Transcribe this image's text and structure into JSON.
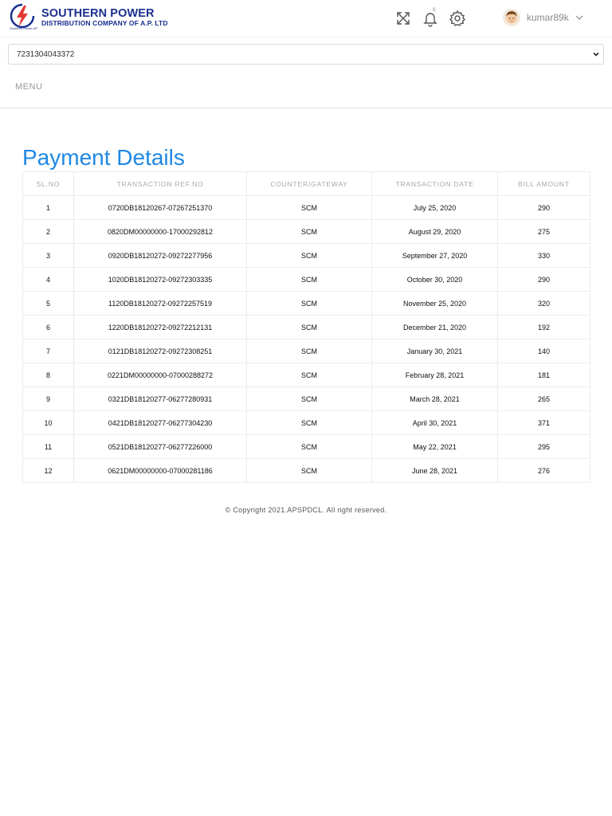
{
  "header": {
    "brand_line1": "SOUTHERN POWER",
    "brand_line2": "DISTRIBUTION COMPANY OF A.P. LTD",
    "brand_tagline": "Southern Power AP",
    "notification_count": "0",
    "username": "kumar89k",
    "icons": {
      "fullscreen": "fullscreen-icon",
      "notifications": "bell-icon",
      "settings": "gear-icon",
      "user_menu": "chevron-down-icon"
    }
  },
  "account": {
    "selected": "7231304043372"
  },
  "menu": {
    "label": "MENU"
  },
  "page": {
    "title": "Payment Details"
  },
  "table": {
    "headers": [
      "SL.NO",
      "TRANSACTION REF.NO",
      "COUNTER/GATEWAY",
      "TRANSACTION DATE",
      "BILL AMOUNT"
    ],
    "rows": [
      [
        "1",
        "0720DB18120267-07267251370",
        "SCM",
        "July 25, 2020",
        "290"
      ],
      [
        "2",
        "0820DM00000000-17000292812",
        "SCM",
        "August 29, 2020",
        "275"
      ],
      [
        "3",
        "0920DB18120272-09272277956",
        "SCM",
        "September 27, 2020",
        "330"
      ],
      [
        "4",
        "1020DB18120272-09272303335",
        "SCM",
        "October 30, 2020",
        "290"
      ],
      [
        "5",
        "1120DB18120272-09272257519",
        "SCM",
        "November 25, 2020",
        "320"
      ],
      [
        "6",
        "1220DB18120272-09272212131",
        "SCM",
        "December 21, 2020",
        "192"
      ],
      [
        "7",
        "0121DB18120272-09272308251",
        "SCM",
        "January 30, 2021",
        "140"
      ],
      [
        "8",
        "0221DM00000000-07000288272",
        "SCM",
        "February 28, 2021",
        "181"
      ],
      [
        "9",
        "0321DB18120277-06277280931",
        "SCM",
        "March 28, 2021",
        "265"
      ],
      [
        "10",
        "0421DB18120277-06277304230",
        "SCM",
        "April 30, 2021",
        "371"
      ],
      [
        "11",
        "0521DB18120277-06277226000",
        "SCM",
        "May 22, 2021",
        "295"
      ],
      [
        "12",
        "0621DM00000000-07000281186",
        "SCM",
        "June 28, 2021",
        "276"
      ]
    ]
  },
  "footer": {
    "copyright": "© Copyright 2021.APSPDCL. All right reserved."
  },
  "colors": {
    "brand": "#1b2f8f",
    "title_blue": "#1e88e5",
    "logo_red": "#e53935"
  }
}
